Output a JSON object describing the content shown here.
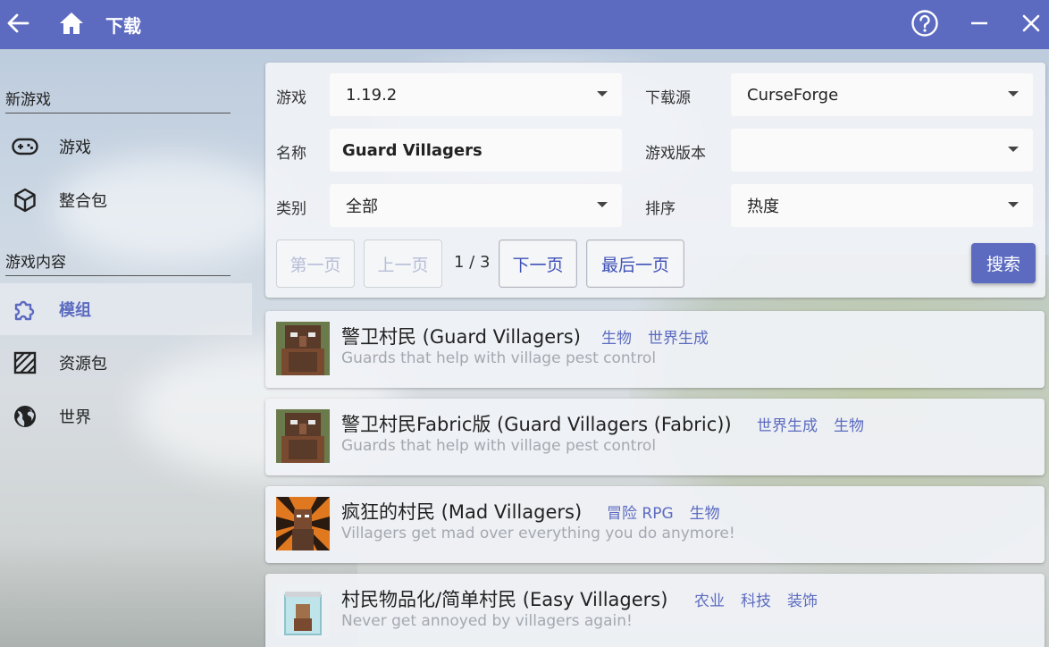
{
  "titlebar": {
    "title": "下载",
    "icons": [
      "back-arrow-icon",
      "home-icon",
      "help-icon",
      "minimize-icon",
      "close-icon"
    ],
    "bg_color": "#5c6bc0"
  },
  "sidebar": {
    "sections": [
      {
        "header": "新游戏",
        "items": [
          {
            "label": "游戏",
            "icon": "gamepad-icon"
          },
          {
            "label": "整合包",
            "icon": "package-icon"
          }
        ]
      },
      {
        "header": "游戏内容",
        "items": [
          {
            "label": "模组",
            "icon": "puzzle-icon",
            "active": true
          },
          {
            "label": "资源包",
            "icon": "texture-icon"
          },
          {
            "label": "世界",
            "icon": "globe-icon"
          }
        ]
      }
    ]
  },
  "search": {
    "game_label": "游戏",
    "game_value": "1.19.2",
    "source_label": "下载源",
    "source_value": "CurseForge",
    "name_label": "名称",
    "name_value": "Guard Villagers",
    "version_label": "游戏版本",
    "version_value": "",
    "category_label": "类别",
    "category_value": "全部",
    "sort_label": "排序",
    "sort_value": "热度",
    "first_page": "第一页",
    "prev_page": "上一页",
    "page_info": "1 / 3",
    "next_page": "下一页",
    "last_page": "最后一页",
    "search_button": "搜索"
  },
  "results": [
    {
      "title": "警卫村民 (Guard Villagers)",
      "tags": [
        "生物",
        "世界生成"
      ],
      "description": "Guards that help with village pest control"
    },
    {
      "title": "警卫村民Fabric版 (Guard Villagers (Fabric))",
      "tags": [
        "世界生成",
        "生物"
      ],
      "description": "Guards that help with village pest control"
    },
    {
      "title": "疯狂的村民 (Mad Villagers)",
      "tags": [
        "冒险 RPG",
        "生物"
      ],
      "description": "Villagers get mad over everything you do anymore!"
    },
    {
      "title": "村民物品化/简单村民 (Easy Villagers)",
      "tags": [
        "农业",
        "科技",
        "装饰"
      ],
      "description": "Never get annoyed by villagers again!"
    }
  ],
  "colors": {
    "accent": "#5c6bc0",
    "tag": "#5c6bc0",
    "description": "#a4a8b0"
  }
}
